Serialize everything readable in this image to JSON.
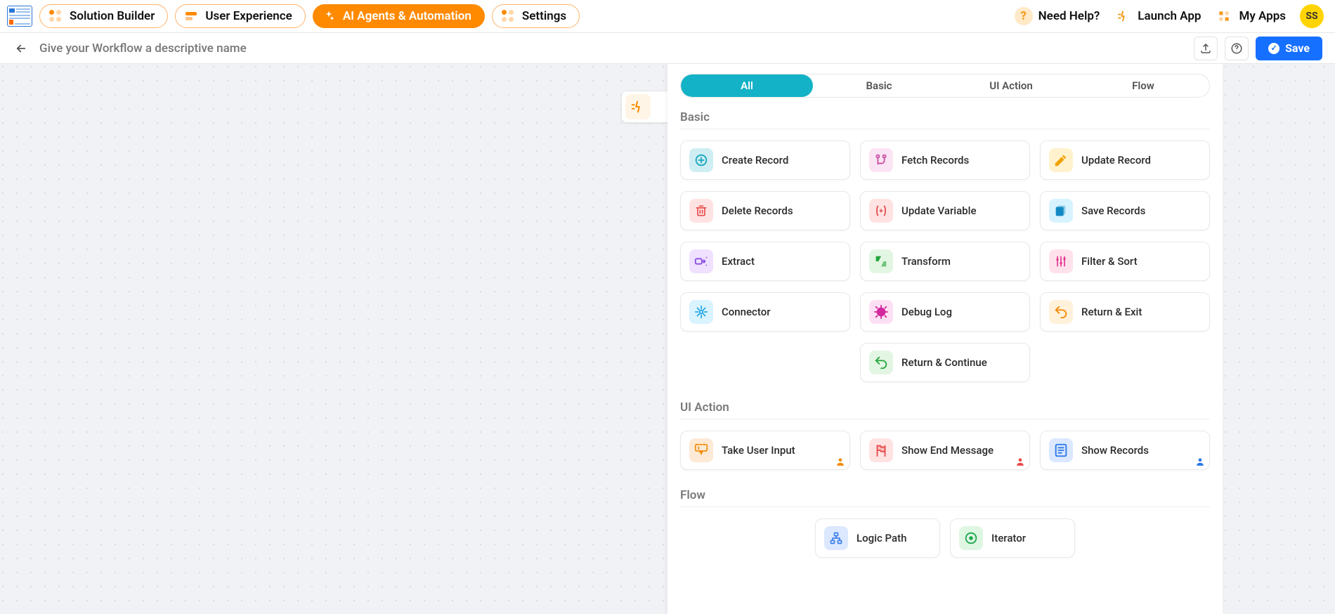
{
  "topbar": {
    "tabs": [
      {
        "label": "Solution Builder",
        "active": false
      },
      {
        "label": "User Experience",
        "active": false
      },
      {
        "label": "AI Agents & Automation",
        "active": true
      },
      {
        "label": "Settings",
        "active": false
      }
    ],
    "help": "Need Help?",
    "launch": "Launch App",
    "myapps": "My Apps",
    "avatar": "SS"
  },
  "subbar": {
    "placeholder": "Give your Workflow a descriptive name",
    "save": "Save"
  },
  "trigger": {
    "label": ""
  },
  "panel": {
    "tabs": [
      "All",
      "Basic",
      "UI Action",
      "Flow"
    ],
    "active_tab": "All",
    "sections": [
      {
        "title": "Basic",
        "cards": [
          {
            "label": "Create Record",
            "bg": "#cfeef3",
            "fg": "#19a6bd",
            "type": "plus"
          },
          {
            "label": "Fetch Records",
            "bg": "#fbe4f3",
            "fg": "#c94fa5",
            "type": "pull"
          },
          {
            "label": "Update Record",
            "bg": "#fff2cc",
            "fg": "#f2a100",
            "type": "pen"
          },
          {
            "label": "Delete Records",
            "bg": "#ffe3e3",
            "fg": "#e84a4a",
            "type": "trash"
          },
          {
            "label": "Update Variable",
            "bg": "#ffe3e3",
            "fg": "#e84a4a",
            "type": "var"
          },
          {
            "label": "Save Records",
            "bg": "#d7f3ff",
            "fg": "#1289c4",
            "type": "save"
          },
          {
            "label": "Extract",
            "bg": "#efe1ff",
            "fg": "#8a4ee6",
            "type": "extract"
          },
          {
            "label": "Transform",
            "bg": "#e3f6e3",
            "fg": "#25a53b",
            "type": "transform"
          },
          {
            "label": "Filter & Sort",
            "bg": "#ffe1ec",
            "fg": "#e2348c",
            "type": "sliders"
          },
          {
            "label": "Connector",
            "bg": "#d9f3ff",
            "fg": "#28a9e6",
            "type": "conn"
          },
          {
            "label": "Debug Log",
            "bg": "#fddff4",
            "fg": "#d2289e",
            "type": "bug"
          },
          {
            "label": "Return & Exit",
            "bg": "#fff1da",
            "fg": "#f28a00",
            "type": "return"
          },
          {
            "label": "Return & Continue",
            "bg": "#e3f6e3",
            "fg": "#27a73f",
            "type": "return",
            "col": "2"
          }
        ]
      },
      {
        "title": "UI Action",
        "cards": [
          {
            "label": "Take User Input",
            "bg": "#fce9d6",
            "fg": "#f28a00",
            "type": "form",
            "badge": "#f28a00"
          },
          {
            "label": "Show End Message",
            "bg": "#ffe3e3",
            "fg": "#e84a4a",
            "type": "flag",
            "badge": "#e84a4a"
          },
          {
            "label": "Show Records",
            "bg": "#dbe8ff",
            "fg": "#2a77e6",
            "type": "list",
            "badge": "#2a77e6"
          }
        ]
      },
      {
        "title": "Flow",
        "centered": true,
        "cards": [
          {
            "label": "Logic Path",
            "bg": "#dbe8ff",
            "fg": "#3d7eea",
            "type": "tree"
          },
          {
            "label": "Iterator",
            "bg": "#dff6e3",
            "fg": "#1ea84e",
            "type": "loop"
          }
        ]
      }
    ]
  }
}
